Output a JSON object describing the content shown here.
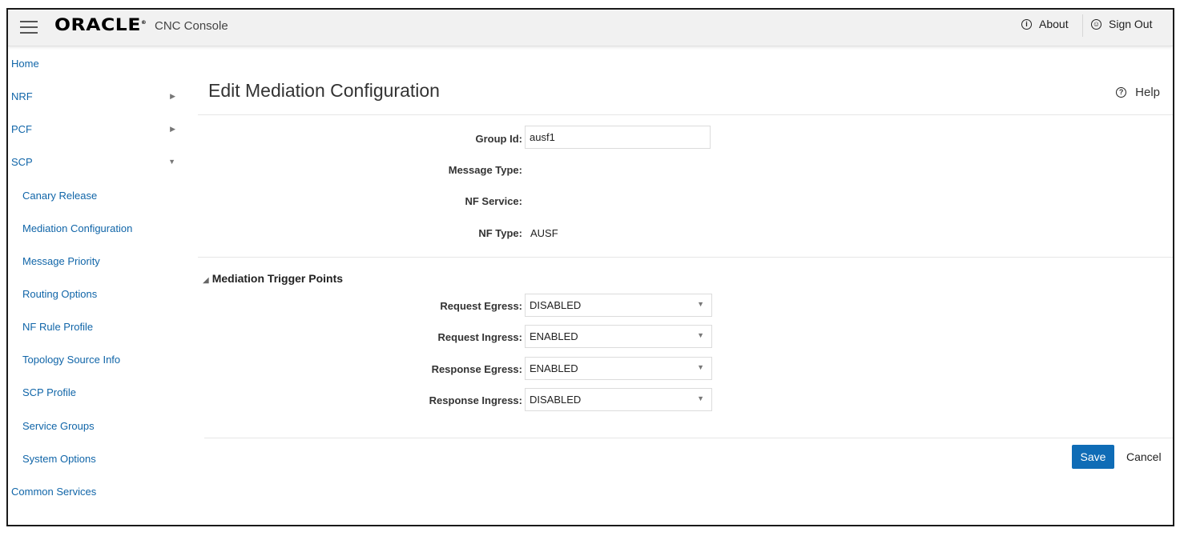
{
  "header": {
    "logo": "ORACLE",
    "logo_mark": "®",
    "app_name": "CNC Console",
    "about_label": "About",
    "sign_out_label": "Sign Out"
  },
  "sidebar": {
    "items": [
      {
        "label": "Home"
      },
      {
        "label": "NRF"
      },
      {
        "label": "PCF"
      },
      {
        "label": "SCP"
      },
      {
        "label": "Canary Release"
      },
      {
        "label": "Mediation Configuration"
      },
      {
        "label": "Message Priority"
      },
      {
        "label": "Routing Options"
      },
      {
        "label": "NF Rule Profile"
      },
      {
        "label": "Topology Source Info"
      },
      {
        "label": "SCP Profile"
      },
      {
        "label": "Service Groups"
      },
      {
        "label": "System Options"
      },
      {
        "label": "Common Services"
      }
    ]
  },
  "main": {
    "title": "Edit Mediation Configuration",
    "help_label": "Help",
    "fields": {
      "group_id_label": "Group Id:",
      "group_id_value": "ausf1",
      "message_type_label": "Message Type:",
      "nf_service_label": "NF Service:",
      "nf_type_label": "NF Type:",
      "nf_type_value": "AUSF"
    },
    "section": {
      "title": "Mediation Trigger Points",
      "request_egress_label": "Request Egress:",
      "request_egress_value": "DISABLED",
      "request_ingress_label": "Request Ingress:",
      "request_ingress_value": "ENABLED",
      "response_egress_label": "Response Egress:",
      "response_egress_value": "ENABLED",
      "response_ingress_label": "Response Ingress:",
      "response_ingress_value": "DISABLED"
    },
    "save_label": "Save",
    "cancel_label": "Cancel"
  },
  "colors": {
    "link": "#1065a8",
    "primary_button": "#0f6cb6",
    "header_bg": "#f1f1f1"
  }
}
